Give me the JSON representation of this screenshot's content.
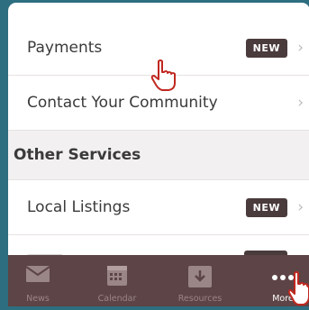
{
  "rows": [
    {
      "label": "Payments",
      "badge": "NEW",
      "chevron": "›"
    },
    {
      "label": "Contact Your Community",
      "chevron": "›"
    }
  ],
  "section": {
    "title": "Other Services"
  },
  "other_rows": [
    {
      "label": "Local Listings",
      "badge": "NEW",
      "chevron": "›"
    }
  ],
  "tabbar": {
    "tabs": [
      {
        "label": "News",
        "icon": "mail-icon",
        "active": false
      },
      {
        "label": "Calendar",
        "icon": "calendar-icon",
        "active": false
      },
      {
        "label": "Resources",
        "icon": "download-icon",
        "active": false
      },
      {
        "label": "More",
        "icon": "more-icon",
        "active": true
      }
    ]
  },
  "colors": {
    "background": "#2d6e80",
    "tabbar": "#5d4446",
    "badge": "#4a3b3d",
    "cursor_outline": "#c0281f"
  }
}
